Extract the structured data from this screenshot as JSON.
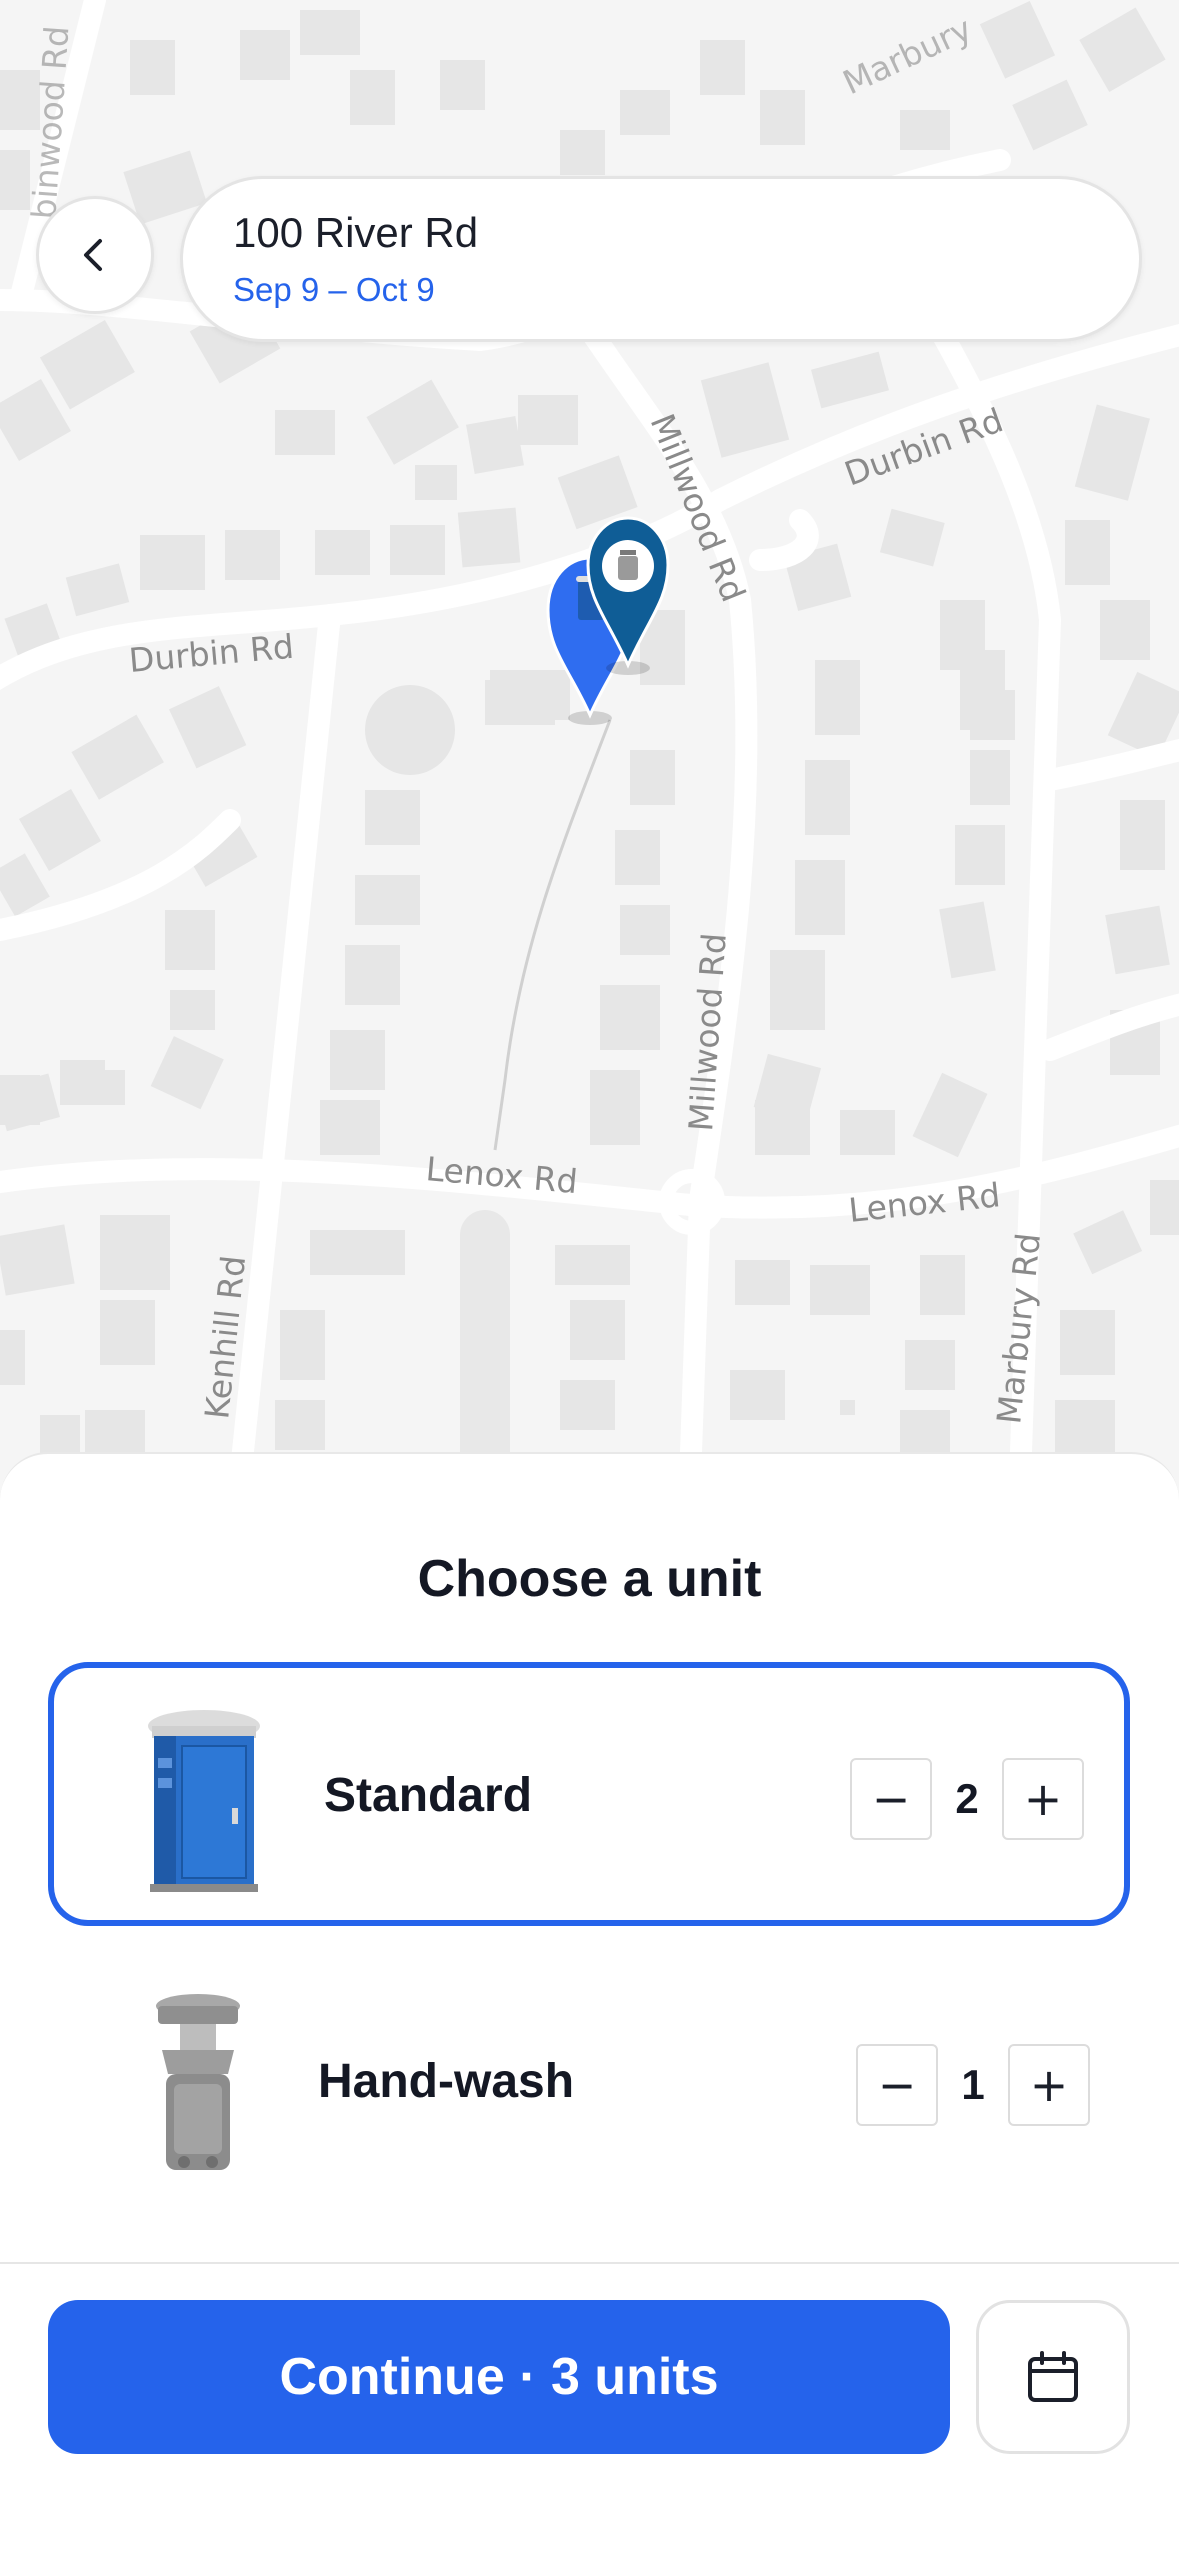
{
  "header": {
    "address": "100 River Rd",
    "dates": "Sep 9 – Oct 9"
  },
  "map": {
    "road_labels": {
      "durbin_left": "Durbin Rd",
      "durbin_right": "Durbin Rd",
      "millwood_top": "Millwood Rd",
      "millwood_mid": "Millwood Rd",
      "lenox_left": "Lenox Rd",
      "lenox_right": "Lenox Rd",
      "kenhill": "Kenhill Rd",
      "marbury_bottom": "Marbury Rd",
      "marbury_top": "Marbury",
      "binwood": "binwood Rd"
    },
    "pins": [
      {
        "icon": "portable-toilet-icon",
        "color": "#2f6df0"
      },
      {
        "icon": "hand-wash-station-icon",
        "color": "#0f5d96"
      }
    ]
  },
  "sheet": {
    "title": "Choose a unit",
    "units": [
      {
        "name": "Standard",
        "quantity": "2",
        "selected": true
      },
      {
        "name": "Hand-wash",
        "quantity": "1",
        "selected": false
      }
    ],
    "stepper": {
      "minus": "−",
      "plus": "+"
    }
  },
  "footer": {
    "continue_label": "Continue · 3 units",
    "calendar_icon": "calendar-icon"
  },
  "colors": {
    "accent": "#2563eb",
    "text": "#141824"
  }
}
